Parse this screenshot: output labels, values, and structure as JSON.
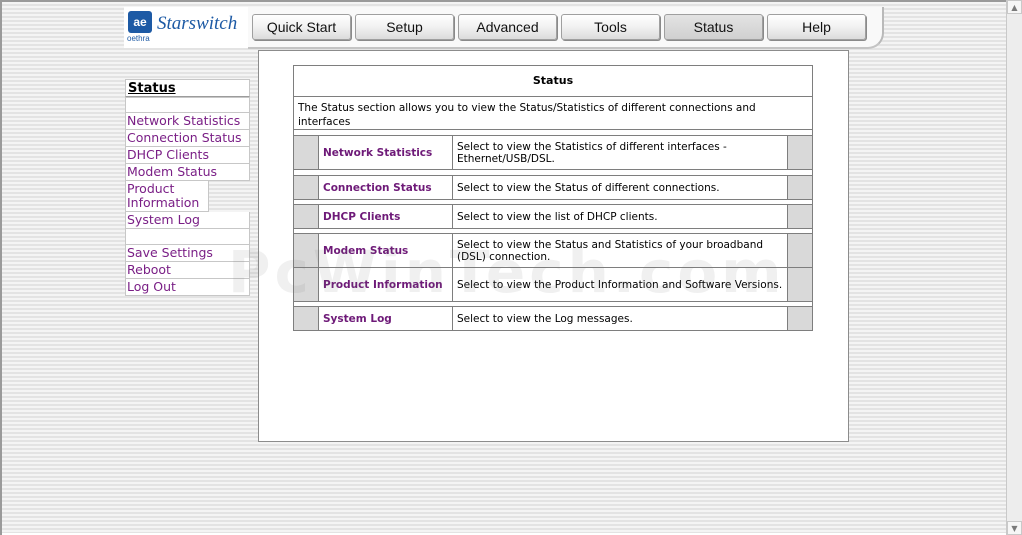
{
  "logo": {
    "mark": "ae",
    "sub": "oethra",
    "name": "Starswitch"
  },
  "tabs": [
    {
      "label": "Quick Start"
    },
    {
      "label": "Setup"
    },
    {
      "label": "Advanced"
    },
    {
      "label": "Tools"
    },
    {
      "label": "Status",
      "active": true
    },
    {
      "label": "Help"
    }
  ],
  "sidebar": {
    "heading": "Status",
    "items": [
      "Network Statistics",
      "Connection Status",
      "DHCP Clients",
      "Modem Status",
      "Product Information",
      "System Log"
    ],
    "actions": [
      "Save Settings",
      "Reboot",
      "Log Out"
    ]
  },
  "main": {
    "title": "Status",
    "description": "The Status section allows you to view the Status/Statistics of different connections and interfaces",
    "rows": [
      {
        "link": "Network Statistics",
        "desc": "Select to view the Statistics of different interfaces - Ethernet/USB/DSL."
      },
      {
        "link": "Connection Status",
        "desc": "Select to view the Status of different connections."
      },
      {
        "link": "DHCP Clients",
        "desc": "Select to view the list of DHCP clients."
      },
      {
        "link": "Modem Status",
        "desc": "Select to view the Status and Statistics of your broadband (DSL) connection."
      },
      {
        "link": "Product Information",
        "desc": "Select to view the Product Information and Software Versions."
      },
      {
        "link": "System Log",
        "desc": "Select to view the Log messages."
      }
    ]
  },
  "watermark": "PcWinTech.com",
  "colors": {
    "link": "#7a1f86",
    "logo": "#1d5aa5",
    "row_marker": "#d9d9d9"
  },
  "scrollbar": {
    "up": "▲",
    "down": "▼"
  }
}
